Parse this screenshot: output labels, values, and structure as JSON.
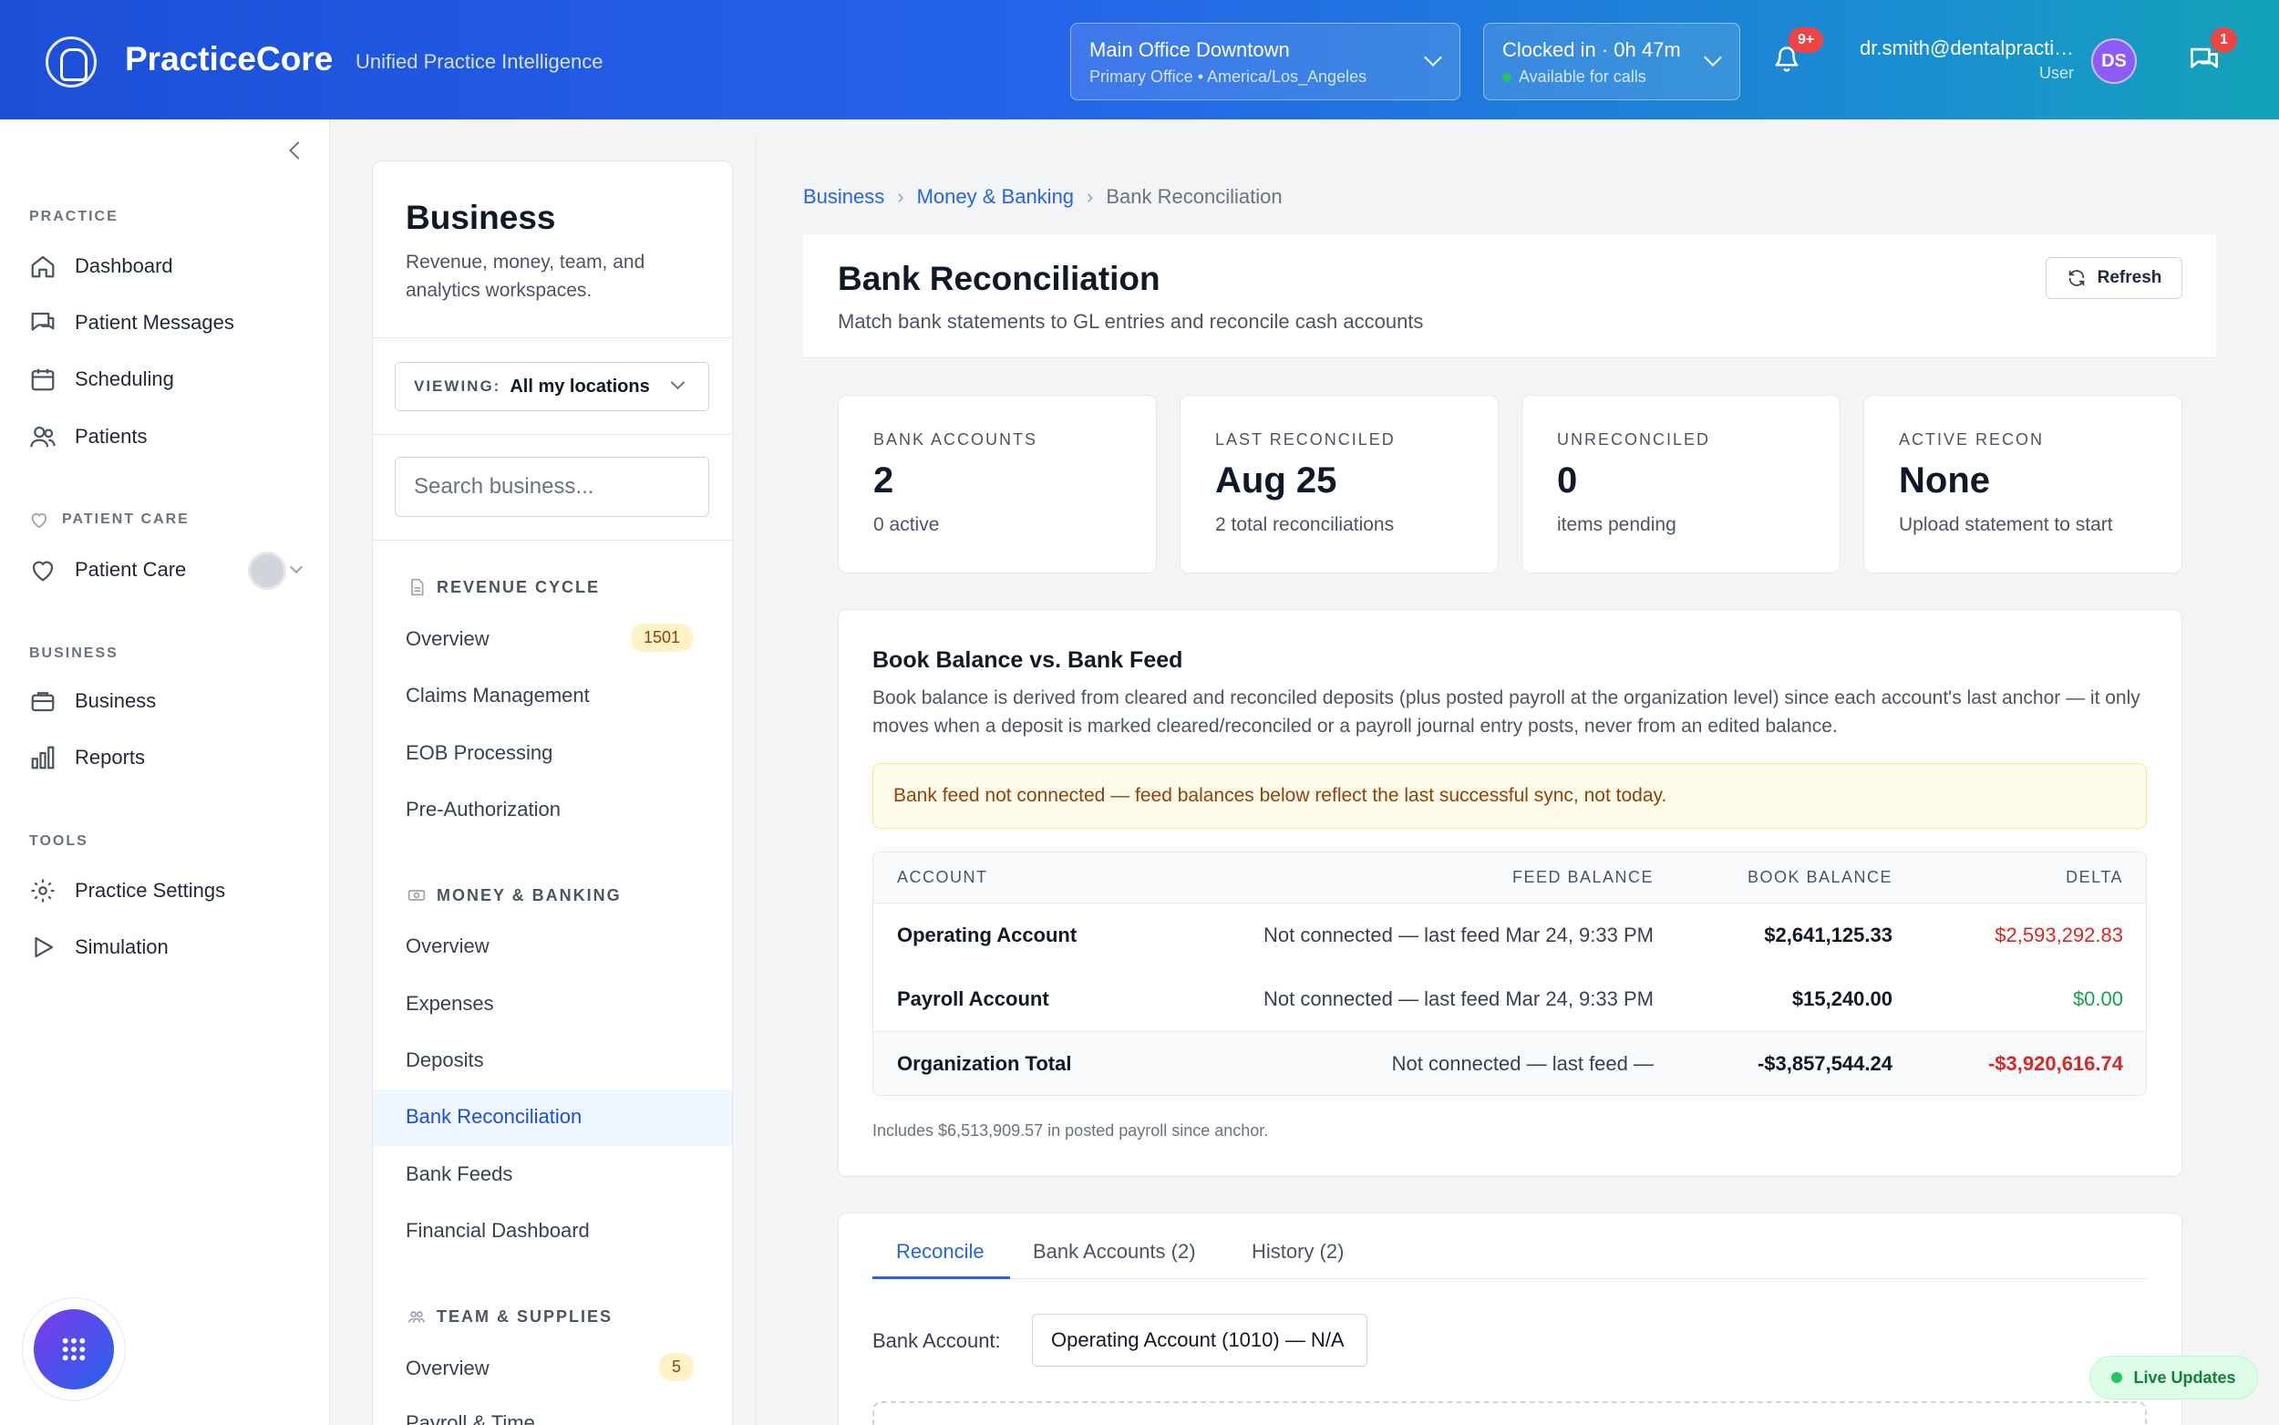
{
  "app": {
    "brand": "PracticeCore",
    "tagline": "Unified Practice Intelligence"
  },
  "topbar": {
    "location": {
      "name": "Main Office Downtown",
      "detail": "Primary Office • America/Los_Angeles"
    },
    "clock": {
      "status": "Clocked in · 0h 47m",
      "availability": "Available for calls"
    },
    "notifications_badge": "9+",
    "user": {
      "email": "dr.smith@dentalpractice.com",
      "role": "User",
      "initials": "DS"
    },
    "messages_badge": "1"
  },
  "sidebar": {
    "sections": [
      {
        "label": "PRACTICE",
        "items": [
          {
            "label": "Dashboard",
            "icon": "home-icon"
          },
          {
            "label": "Patient Messages",
            "icon": "chat-icon"
          },
          {
            "label": "Scheduling",
            "icon": "calendar-icon"
          },
          {
            "label": "Patients",
            "icon": "users-icon"
          }
        ]
      },
      {
        "label": "PATIENT CARE",
        "items": [
          {
            "label": "Patient Care",
            "icon": "heart-icon"
          }
        ]
      },
      {
        "label": "BUSINESS",
        "items": [
          {
            "label": "Business",
            "icon": "briefcase-icon"
          },
          {
            "label": "Reports",
            "icon": "bar-chart-icon"
          }
        ]
      },
      {
        "label": "TOOLS",
        "items": [
          {
            "label": "Practice Settings",
            "icon": "gear-icon"
          },
          {
            "label": "Simulation",
            "icon": "play-icon"
          }
        ]
      }
    ]
  },
  "business_panel": {
    "title": "Business",
    "description": "Revenue, money, team, and analytics workspaces.",
    "viewing_label": "VIEWING:",
    "viewing_value": "All my locations",
    "search_placeholder": "Search business...",
    "groups": [
      {
        "label": "REVENUE CYCLE",
        "items": [
          "Overview",
          "Claims Management",
          "EOB Processing",
          "Pre-Authorization"
        ],
        "overview_count": "1501"
      },
      {
        "label": "MONEY & BANKING",
        "items": [
          "Overview",
          "Expenses",
          "Deposits",
          "Bank Reconciliation",
          "Bank Feeds",
          "Financial Dashboard"
        ]
      },
      {
        "label": "TEAM & SUPPLIES",
        "items": [
          "Overview",
          "Payroll & Time"
        ],
        "overview_count": "5"
      }
    ]
  },
  "breadcrumb": [
    "Business",
    "Money & Banking",
    "Bank Reconciliation"
  ],
  "page": {
    "title": "Bank Reconciliation",
    "subtitle": "Match bank statements to GL entries and reconcile cash accounts",
    "refresh_label": "Refresh"
  },
  "stats": [
    {
      "label": "BANK ACCOUNTS",
      "value": "2",
      "sub": "0 active"
    },
    {
      "label": "LAST RECONCILED",
      "value": "Aug 25",
      "sub": "2 total reconciliations"
    },
    {
      "label": "UNRECONCILED",
      "value": "0",
      "sub": "items pending"
    },
    {
      "label": "ACTIVE RECON",
      "value": "None",
      "sub": "Upload statement to start"
    }
  ],
  "book_balance": {
    "title": "Book Balance vs. Bank Feed",
    "description": "Book balance is derived from cleared and reconciled deposits (plus posted payroll at the organization level) since each account's last anchor — it only moves when a deposit is marked cleared/reconciled or a payroll journal entry posts, never from an edited balance.",
    "warning": "Bank feed not connected — feed balances below reflect the last successful sync, not today.",
    "columns": [
      "ACCOUNT",
      "FEED BALANCE",
      "BOOK BALANCE",
      "DELTA"
    ],
    "rows": [
      {
        "account": "Operating Account",
        "feed": "Not connected — last feed Mar 24, 9:33 PM",
        "book": "$2,641,125.33",
        "delta": "$2,593,292.83",
        "delta_status": "negative"
      },
      {
        "account": "Payroll Account",
        "feed": "Not connected — last feed Mar 24, 9:33 PM",
        "book": "$15,240.00",
        "delta": "$0.00",
        "delta_status": "positive"
      },
      {
        "account": "Organization Total",
        "feed": "Not connected — last feed —",
        "book": "-$3,857,544.24",
        "delta": "-$3,920,616.74",
        "delta_status": "negative"
      }
    ],
    "footnote": "Includes $6,513,909.57 in posted payroll since anchor."
  },
  "tabs": [
    "Reconcile",
    "Bank Accounts (2)",
    "History (2)"
  ],
  "reconcile": {
    "bank_account_label": "Bank Account:",
    "bank_account_value": "Operating Account (1010) — N/A"
  },
  "live_updates": "Live Updates",
  "colors": {
    "accent": "#2563eb",
    "negative": "#dc2626",
    "positive": "#16a34a",
    "warning_bg": "#fefce8"
  }
}
